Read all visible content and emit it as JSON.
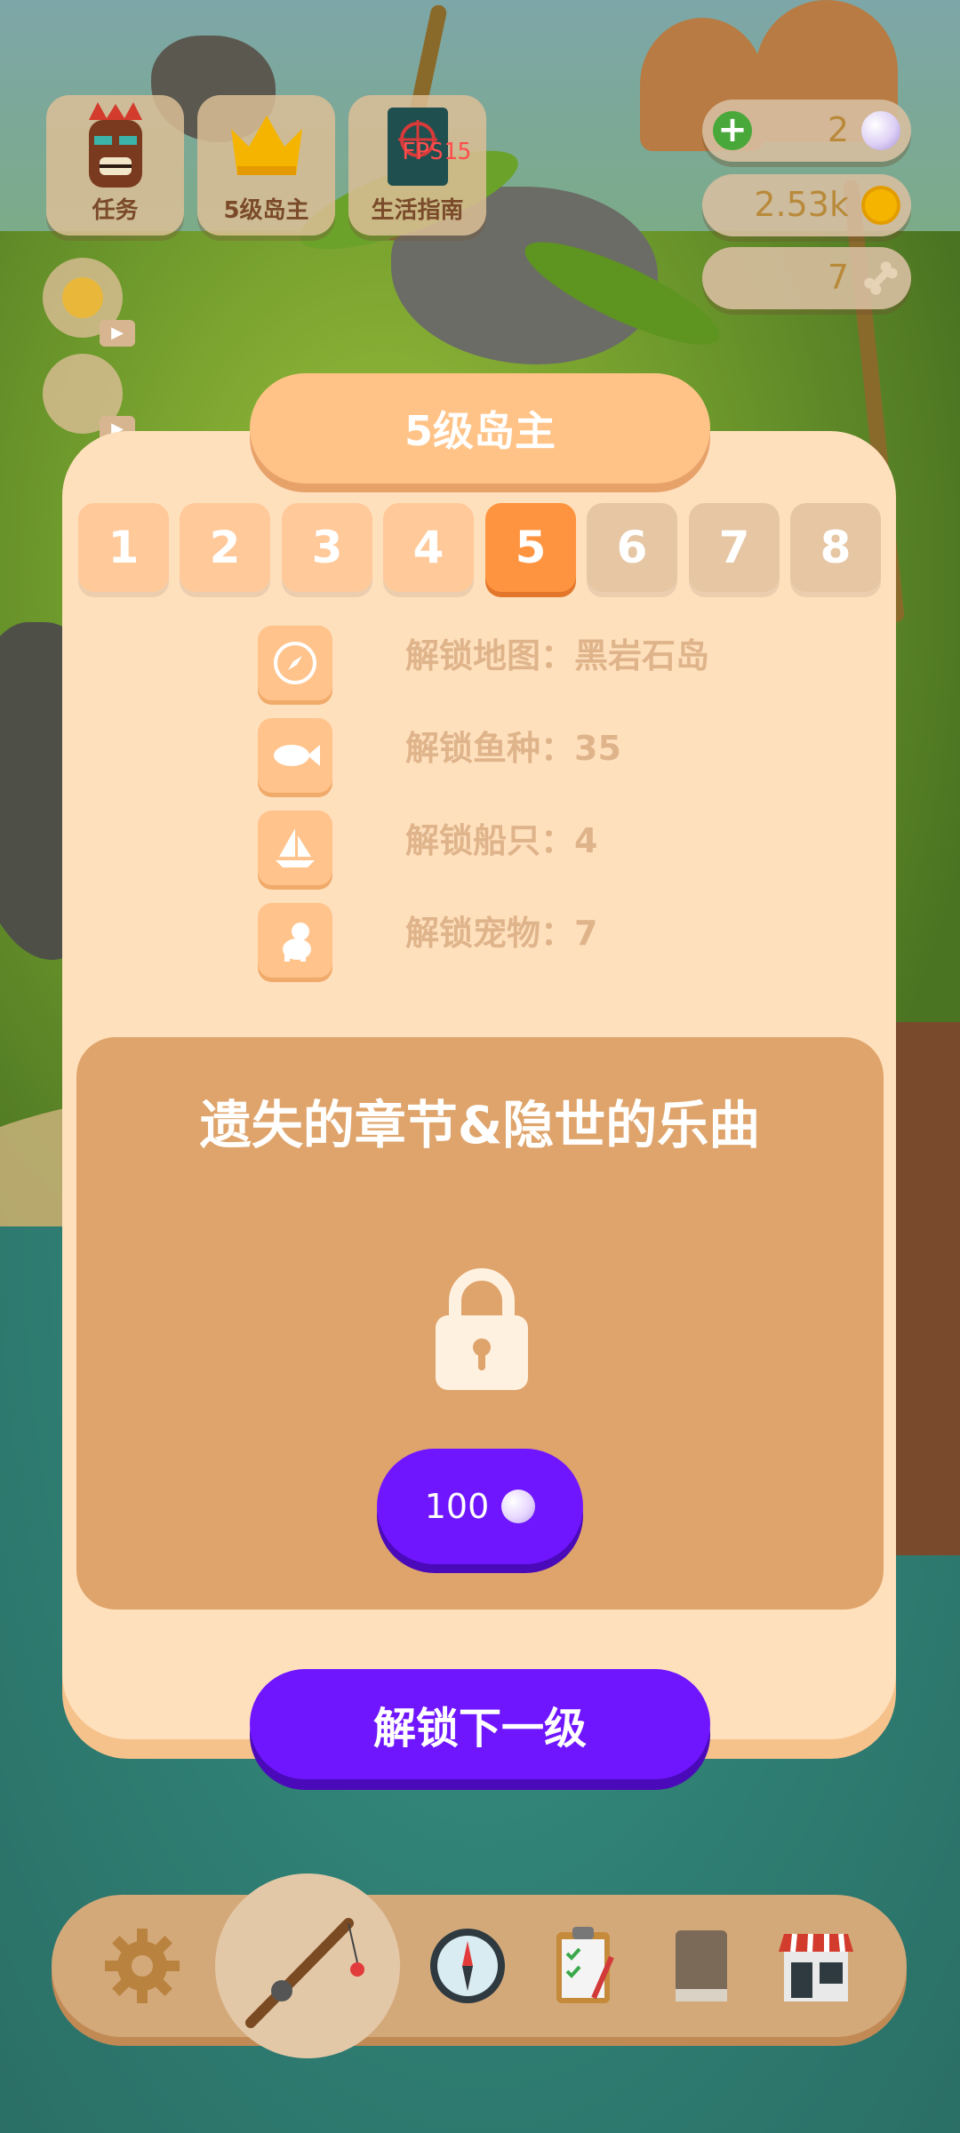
{
  "hud": {
    "task_label": "任务",
    "rank_label": "5级岛主",
    "guide_label": "生活指南",
    "fps": "FPS15"
  },
  "resources": {
    "pearls": "2",
    "coins": "2.53k",
    "bones": "7"
  },
  "panel": {
    "title": "5级岛主",
    "levels": [
      "1",
      "2",
      "3",
      "4",
      "5",
      "6",
      "7",
      "8"
    ],
    "current_level": 5,
    "unlocks": [
      {
        "icon": "compass-icon",
        "text": "解锁地图：黑岩石岛"
      },
      {
        "icon": "fish-icon",
        "text": "解锁鱼种：35"
      },
      {
        "icon": "boat-icon",
        "text": "解锁船只：4"
      },
      {
        "icon": "dog-icon",
        "text": "解锁宠物：7"
      }
    ],
    "chapter_title": "遗失的章节&隐世的乐曲",
    "price": "100",
    "next_button": "解锁下一级"
  },
  "colors": {
    "panel_bg": "#ffe0bd",
    "title_pill": "#ffc387",
    "current_level": "#ff9440",
    "purple_button": "#6f16ff"
  }
}
